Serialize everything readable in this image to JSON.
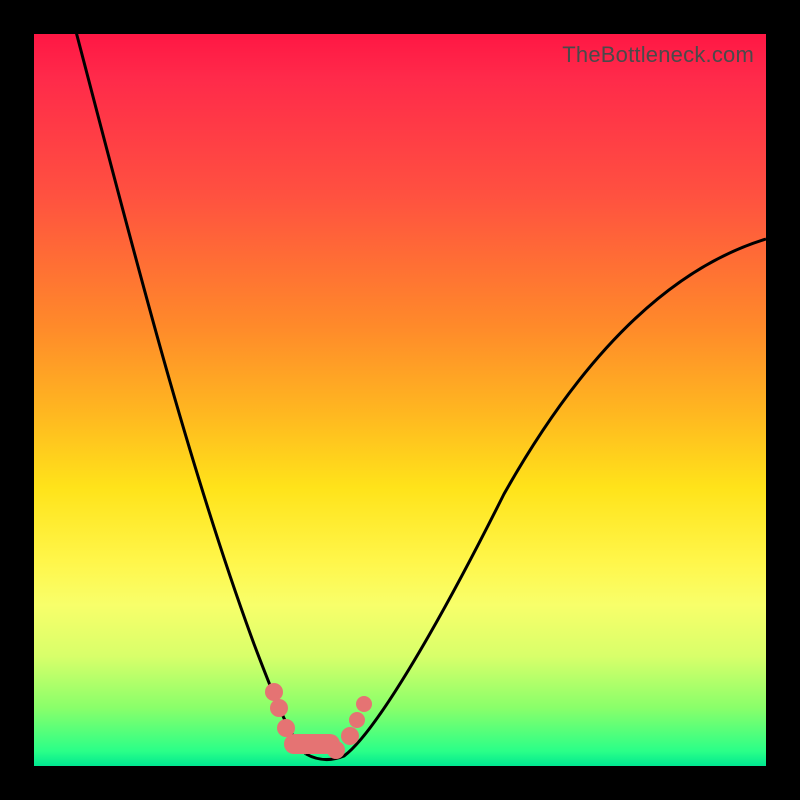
{
  "attribution": {
    "watermark": "TheBottleneck.com"
  },
  "colors": {
    "background": "#000000",
    "curve_stroke": "#000000",
    "marker_fill": "#e57373",
    "gradient_stops": [
      "#ff1744",
      "#ff8a2a",
      "#ffe31a",
      "#d8ff6a",
      "#00e890"
    ]
  },
  "chart_data": {
    "type": "line",
    "title": "",
    "xlabel": "",
    "ylabel": "",
    "xlim": [
      0,
      100
    ],
    "ylim": [
      0,
      100
    ],
    "note": "Axes unlabeled; values estimated from pixel position on a 0–100 normalized scale. Curve is a V-shaped bottleneck profile with minimum near x≈37.",
    "series": [
      {
        "name": "bottleneck-curve",
        "x": [
          5,
          10,
          15,
          20,
          25,
          30,
          33,
          35,
          37,
          40,
          43,
          45,
          50,
          55,
          60,
          65,
          70,
          75,
          80,
          85,
          90,
          95,
          100
        ],
        "y": [
          100,
          85,
          70,
          55,
          40,
          20,
          8,
          3,
          0,
          0,
          3,
          7,
          15,
          24,
          32,
          40,
          47,
          54,
          60,
          65,
          69,
          72,
          74
        ]
      }
    ],
    "markers": {
      "name": "highlighted-points",
      "x": [
        32,
        33,
        34,
        36,
        38,
        40,
        42,
        43,
        44
      ],
      "y": [
        10,
        7,
        4,
        1,
        0,
        0,
        2,
        5,
        8
      ]
    }
  }
}
